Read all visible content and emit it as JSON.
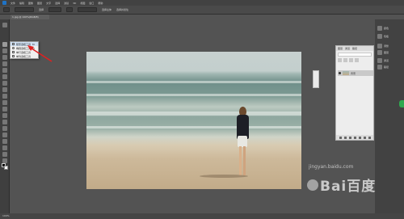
{
  "menubar": {
    "items": [
      "文件",
      "编辑",
      "图像",
      "图层",
      "文字",
      "选择",
      "滤镜",
      "3D",
      "视图",
      "窗口",
      "帮助"
    ]
  },
  "options": {
    "mode_label": "选择",
    "field_label": "选择主体",
    "extra_label": "选择并遮住"
  },
  "document": {
    "tab_title": "1.jpg @ 100%(RGB/8)"
  },
  "tool_flyout": {
    "items": [
      {
        "label": "矩形选框工具",
        "shortcut": "M",
        "selected": true
      },
      {
        "label": "椭圆选框工具",
        "shortcut": "M",
        "selected": false
      },
      {
        "label": "单行选框工具",
        "shortcut": "",
        "selected": false
      },
      {
        "label": "单列选框工具",
        "shortcut": "",
        "selected": false
      }
    ]
  },
  "right_panel": {
    "icons": [
      {
        "name": "color-icon",
        "label": "颜色"
      },
      {
        "name": "swatches-icon",
        "label": "色板"
      },
      {
        "name": "adjust-icon",
        "label": "调整"
      },
      {
        "name": "layers-icon",
        "label": "图层"
      },
      {
        "name": "channels-icon",
        "label": "通道"
      },
      {
        "name": "paths-icon",
        "label": "路径"
      }
    ]
  },
  "layers_panel": {
    "tabs": [
      "图层",
      "通道",
      "路径"
    ],
    "layer": {
      "name": "背景"
    }
  },
  "status": {
    "zoom": "100%"
  },
  "watermark": {
    "brand": "Bai百度",
    "sub": "jingyan.baidu.com"
  },
  "colors": {
    "accent": "#2fa84f",
    "canvas_bg": "#535353",
    "annotation_arrow": "#e02020"
  }
}
